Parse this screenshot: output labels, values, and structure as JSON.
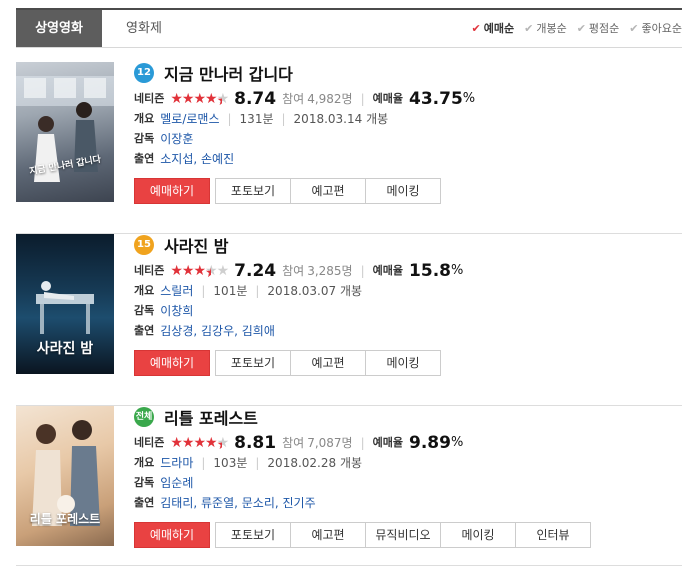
{
  "tabs": [
    "상영영화",
    "영화제"
  ],
  "sorts": [
    {
      "label": "예매순",
      "active": true
    },
    {
      "label": "개봉순",
      "active": false
    },
    {
      "label": "평점순",
      "active": false
    },
    {
      "label": "좋아요순",
      "active": false
    }
  ],
  "labels": {
    "netizen": "네티즌",
    "participants_prefix": "참여",
    "reservation_rate": "예매율",
    "overview": "개요",
    "director": "감독",
    "cast": "출연"
  },
  "movies": [
    {
      "grade": "12",
      "grade_color": "#2a9ad7",
      "title": "지금 만나러 갑니다",
      "stars": 4.5,
      "stars_display": "★★★★★",
      "score": "8.74",
      "participants": "4,982명",
      "rate": "43.75",
      "rate_unit": "%",
      "genre": "멜로/로맨스",
      "runtime": "131분",
      "release": "2018.03.14 개봉",
      "director": "이장훈",
      "cast": "소지섭, 손예진",
      "poster_title": "지금 만나러 갑니다",
      "buttons": [
        "예매하기",
        "포토보기",
        "예고편",
        "메이킹"
      ]
    },
    {
      "grade": "15",
      "grade_color": "#f0a31e",
      "title": "사라진 밤",
      "stars": 3.5,
      "stars_display": "★★★★★",
      "score": "7.24",
      "participants": "3,285명",
      "rate": "15.8",
      "rate_unit": "%",
      "genre": "스릴러",
      "runtime": "101분",
      "release": "2018.03.07 개봉",
      "director": "이창희",
      "cast": "김상경, 김강우, 김희애",
      "poster_title": "사라진 밤",
      "buttons": [
        "예매하기",
        "포토보기",
        "예고편",
        "메이킹"
      ]
    },
    {
      "grade": "전체",
      "grade_color": "#3aa84c",
      "title": "리틀 포레스트",
      "stars": 4.5,
      "stars_display": "★★★★★",
      "score": "8.81",
      "participants": "7,087명",
      "rate": "9.89",
      "rate_unit": "%",
      "genre": "드라마",
      "runtime": "103분",
      "release": "2018.02.28 개봉",
      "director": "임순례",
      "cast": "김태리, 류준열, 문소리, 진기주",
      "poster_title": "리틀 포레스트",
      "buttons": [
        "예매하기",
        "포토보기",
        "예고편",
        "뮤직비디오",
        "메이킹",
        "인터뷰"
      ]
    }
  ]
}
